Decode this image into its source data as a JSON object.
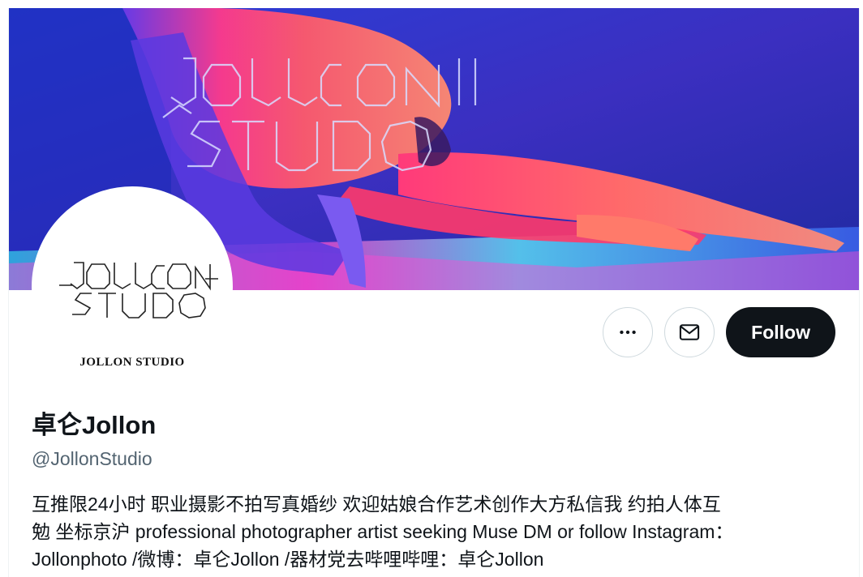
{
  "banner": {
    "image_name": "banner-photo",
    "overlay_logo": "jollon-studio-logo"
  },
  "avatar": {
    "image_name": "jollon-studio-logo",
    "caption": "JOLLON STUDIO"
  },
  "actions": {
    "more_icon": "more-horizontal-icon",
    "message_icon": "mail-icon",
    "follow_label": "Follow"
  },
  "profile": {
    "display_name": "卓仑Jollon",
    "handle": "@JollonStudio",
    "bio": "互推限24小时 职业摄影不拍写真婚纱 欢迎姑娘合作艺术创作大方私信我 约拍人体互\n勉 坐标京沪 professional photographer artist seeking Muse DM or follow Instagram：\nJollonphoto /微博：卓仑Jollon /器材党去哔哩哔哩：卓仑Jollon"
  },
  "colors": {
    "follow_bg": "#0f1419",
    "follow_text": "#ffffff",
    "handle": "#536471",
    "border": "#cfd9de"
  }
}
